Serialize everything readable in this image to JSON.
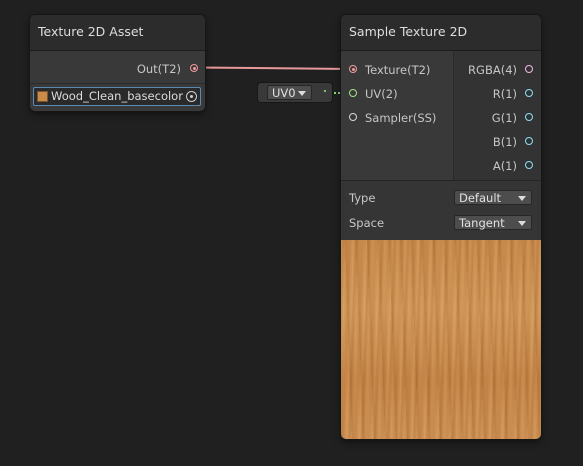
{
  "texture_asset_node": {
    "title": "Texture 2D Asset",
    "output_label": "Out(T2)",
    "asset_field": "Wood_Clean_basecolor"
  },
  "uv_inline": {
    "value": "UV0"
  },
  "sample_node": {
    "title": "Sample Texture 2D",
    "inputs": [
      {
        "label": "Texture(T2)"
      },
      {
        "label": "UV(2)"
      },
      {
        "label": "Sampler(SS)"
      }
    ],
    "outputs": [
      {
        "label": "RGBA(4)"
      },
      {
        "label": "R(1)"
      },
      {
        "label": "G(1)"
      },
      {
        "label": "B(1)"
      },
      {
        "label": "A(1)"
      }
    ],
    "type_label": "Type",
    "type_value": "Default",
    "space_label": "Space",
    "space_value": "Tangent"
  },
  "colors": {
    "texture_port": "#f29a9a",
    "uv_port": "#9ee58a",
    "rgba_port": "#f0b8e8",
    "float_port": "#88e0f5",
    "texture_swatch": "#c98a4a"
  }
}
